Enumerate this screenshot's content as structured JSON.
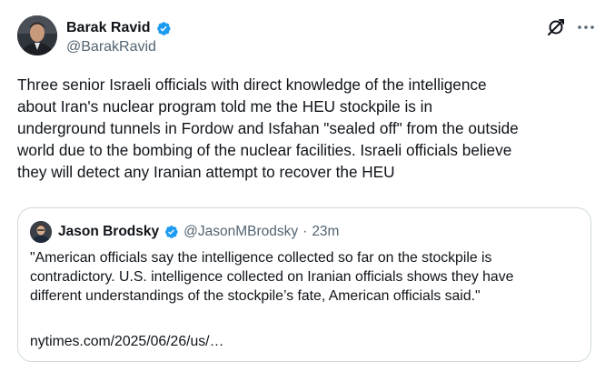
{
  "author": {
    "display_name": "Barak Ravid",
    "handle": "@BarakRavid",
    "verified_icon": "verified-badge-icon"
  },
  "actions": {
    "grok_icon": "grok-icon",
    "more_icon": "more-icon"
  },
  "tweet": {
    "text": "Three senior Israeli officials with direct knowledge of the intelligence\nabout Iran's nuclear program told me the HEU stockpile is in\nunderground tunnels in Fordow and Isfahan \"sealed off\" from the outside\nworld due to the bombing of the nuclear facilities. Israeli officials believe\nthey will detect any Iranian attempt to recover the HEU"
  },
  "quote": {
    "display_name": "Jason Brodsky",
    "handle": "@JasonMBrodsky",
    "separator": "·",
    "time": "23m",
    "text": "\"American officials say the intelligence collected so far on the stockpile is\ncontradictory. U.S. intelligence collected on Iranian officials shows they have\ndifferent understandings of the stockpile’s fate, American officials said.\"",
    "link": "nytimes.com/2025/06/26/us/…"
  },
  "colors": {
    "text_primary": "#0f1419",
    "text_secondary": "#536471",
    "verified_blue": "#1d9bf0",
    "border": "#cfd9de"
  }
}
